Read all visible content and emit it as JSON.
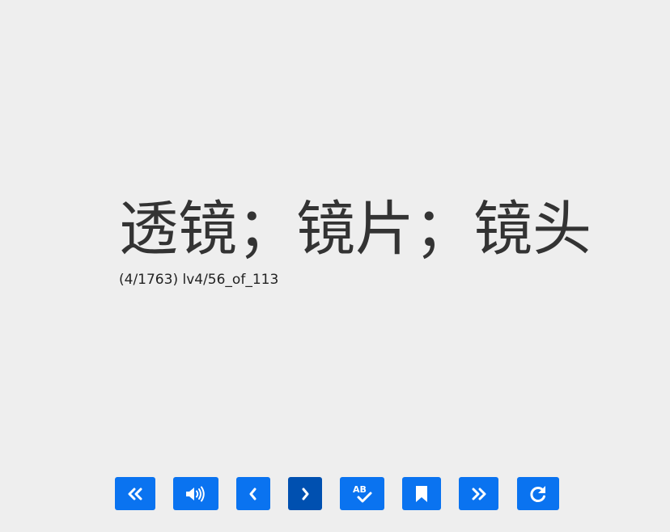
{
  "flashcard": {
    "word": "透镜；镜片；镜头",
    "progress": "(4/1763) lv4/56_of_113"
  },
  "toolbar": {
    "buttons": [
      {
        "name": "first-button",
        "icon": "double-chevron-left-icon"
      },
      {
        "name": "audio-button",
        "icon": "speaker-icon"
      },
      {
        "name": "previous-button",
        "icon": "chevron-left-icon"
      },
      {
        "name": "next-button",
        "icon": "chevron-right-icon",
        "state": "active"
      },
      {
        "name": "spell-check-button",
        "icon": "spell-check-icon"
      },
      {
        "name": "bookmark-button",
        "icon": "bookmark-icon"
      },
      {
        "name": "last-button",
        "icon": "double-chevron-right-icon"
      },
      {
        "name": "reload-button",
        "icon": "redo-icon"
      }
    ]
  },
  "colors": {
    "background": "#eeeeee",
    "button": "#0a73f0",
    "button_active": "#0050b0",
    "icon": "#ffffff",
    "text": "#333333"
  }
}
